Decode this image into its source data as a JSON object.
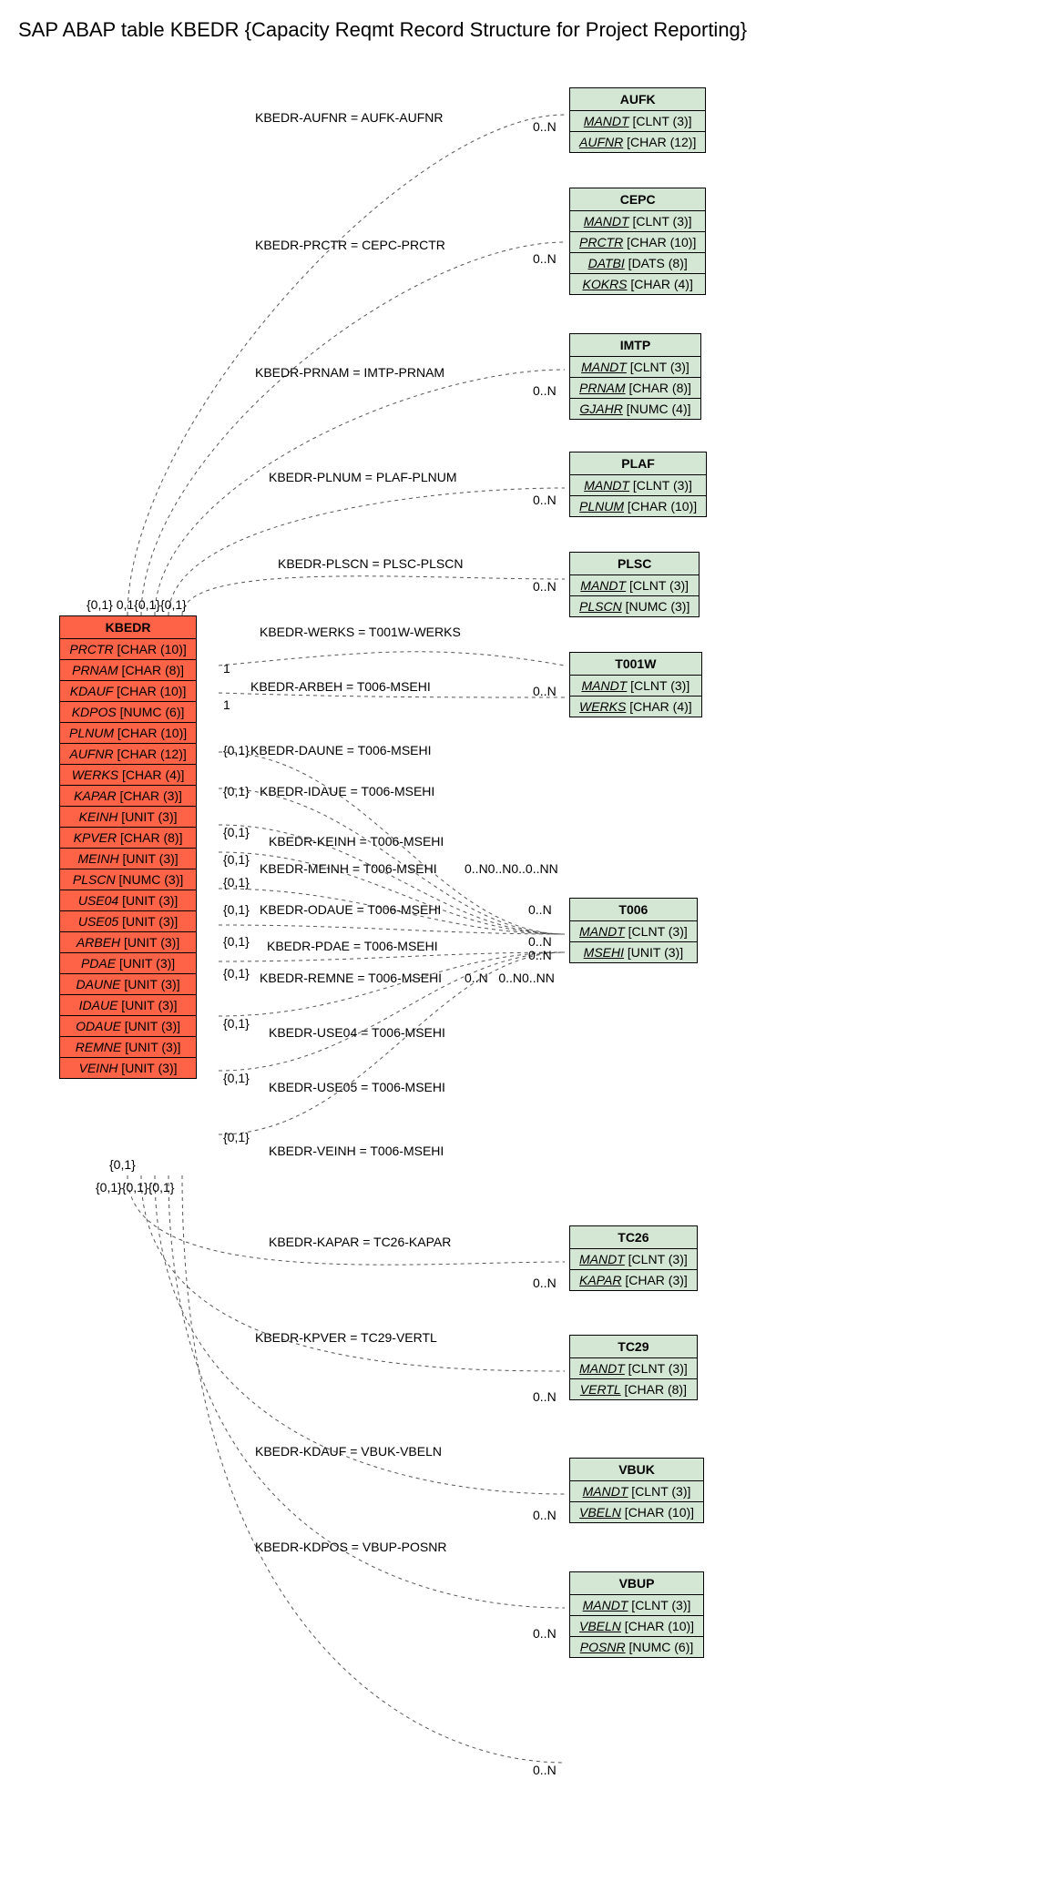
{
  "title": "SAP ABAP table KBEDR {Capacity Reqmt Record Structure for Project Reporting}",
  "main_entity": {
    "name": "KBEDR",
    "fields": [
      {
        "name": "PRCTR",
        "type": "[CHAR (10)]"
      },
      {
        "name": "PRNAM",
        "type": "[CHAR (8)]"
      },
      {
        "name": "KDAUF",
        "type": "[CHAR (10)]"
      },
      {
        "name": "KDPOS",
        "type": "[NUMC (6)]"
      },
      {
        "name": "PLNUM",
        "type": "[CHAR (10)]"
      },
      {
        "name": "AUFNR",
        "type": "[CHAR (12)]"
      },
      {
        "name": "WERKS",
        "type": "[CHAR (4)]"
      },
      {
        "name": "KAPAR",
        "type": "[CHAR (3)]"
      },
      {
        "name": "KEINH",
        "type": "[UNIT (3)]"
      },
      {
        "name": "KPVER",
        "type": "[CHAR (8)]"
      },
      {
        "name": "MEINH",
        "type": "[UNIT (3)]"
      },
      {
        "name": "PLSCN",
        "type": "[NUMC (3)]"
      },
      {
        "name": "USE04",
        "type": "[UNIT (3)]"
      },
      {
        "name": "USE05",
        "type": "[UNIT (3)]"
      },
      {
        "name": "ARBEH",
        "type": "[UNIT (3)]"
      },
      {
        "name": "PDAE",
        "type": "[UNIT (3)]"
      },
      {
        "name": "DAUNE",
        "type": "[UNIT (3)]"
      },
      {
        "name": "IDAUE",
        "type": "[UNIT (3)]"
      },
      {
        "name": "ODAUE",
        "type": "[UNIT (3)]"
      },
      {
        "name": "REMNE",
        "type": "[UNIT (3)]"
      },
      {
        "name": "VEINH",
        "type": "[UNIT (3)]"
      }
    ]
  },
  "related_entities": [
    {
      "name": "AUFK",
      "fields": [
        {
          "name": "MANDT",
          "type": "[CLNT (3)]",
          "u": true
        },
        {
          "name": "AUFNR",
          "type": "[CHAR (12)]",
          "u": true
        }
      ]
    },
    {
      "name": "CEPC",
      "fields": [
        {
          "name": "MANDT",
          "type": "[CLNT (3)]",
          "u": true
        },
        {
          "name": "PRCTR",
          "type": "[CHAR (10)]",
          "u": true
        },
        {
          "name": "DATBI",
          "type": "[DATS (8)]",
          "u": true
        },
        {
          "name": "KOKRS",
          "type": "[CHAR (4)]",
          "u": true
        }
      ]
    },
    {
      "name": "IMTP",
      "fields": [
        {
          "name": "MANDT",
          "type": "[CLNT (3)]",
          "u": true
        },
        {
          "name": "PRNAM",
          "type": "[CHAR (8)]",
          "u": true
        },
        {
          "name": "GJAHR",
          "type": "[NUMC (4)]",
          "u": true
        }
      ]
    },
    {
      "name": "PLAF",
      "fields": [
        {
          "name": "MANDT",
          "type": "[CLNT (3)]",
          "u": true
        },
        {
          "name": "PLNUM",
          "type": "[CHAR (10)]",
          "u": true
        }
      ]
    },
    {
      "name": "PLSC",
      "fields": [
        {
          "name": "MANDT",
          "type": "[CLNT (3)]",
          "u": true
        },
        {
          "name": "PLSCN",
          "type": "[NUMC (3)]",
          "u": true
        }
      ]
    },
    {
      "name": "T001W",
      "fields": [
        {
          "name": "MANDT",
          "type": "[CLNT (3)]",
          "u": true
        },
        {
          "name": "WERKS",
          "type": "[CHAR (4)]",
          "u": true
        }
      ]
    },
    {
      "name": "T006",
      "fields": [
        {
          "name": "MANDT",
          "type": "[CLNT (3)]",
          "u": true
        },
        {
          "name": "MSEHI",
          "type": "[UNIT (3)]",
          "u": true
        }
      ]
    },
    {
      "name": "TC26",
      "fields": [
        {
          "name": "MANDT",
          "type": "[CLNT (3)]",
          "u": true
        },
        {
          "name": "KAPAR",
          "type": "[CHAR (3)]",
          "u": true
        }
      ]
    },
    {
      "name": "TC29",
      "fields": [
        {
          "name": "MANDT",
          "type": "[CLNT (3)]",
          "u": true
        },
        {
          "name": "VERTL",
          "type": "[CHAR (8)]",
          "u": true
        }
      ]
    },
    {
      "name": "VBUK",
      "fields": [
        {
          "name": "MANDT",
          "type": "[CLNT (3)]",
          "u": true
        },
        {
          "name": "VBELN",
          "type": "[CHAR (10)]",
          "u": true
        }
      ]
    },
    {
      "name": "VBUP",
      "fields": [
        {
          "name": "MANDT",
          "type": "[CLNT (3)]",
          "u": true
        },
        {
          "name": "VBELN",
          "type": "[CHAR (10)]",
          "u": true
        },
        {
          "name": "POSNR",
          "type": "[NUMC (6)]",
          "u": true
        }
      ]
    }
  ],
  "relationships": [
    {
      "label": "KBEDR-AUFNR = AUFK-AUFNR",
      "src_card": "{0,1}",
      "dst_card": "0..N"
    },
    {
      "label": "KBEDR-PRCTR = CEPC-PRCTR",
      "src_card": "0,1",
      "dst_card": "0..N"
    },
    {
      "label": "KBEDR-PRNAM = IMTP-PRNAM",
      "src_card": "{0,1}",
      "dst_card": "0..N"
    },
    {
      "label": "KBEDR-PLNUM = PLAF-PLNUM",
      "src_card": "{0,1}",
      "dst_card": "0..N"
    },
    {
      "label": "KBEDR-PLSCN = PLSC-PLSCN",
      "src_card": "{0,1}",
      "dst_card": "0..N"
    },
    {
      "label": "KBEDR-WERKS = T001W-WERKS",
      "src_card": "1",
      "dst_card": "0..N"
    },
    {
      "label": "KBEDR-ARBEH = T006-MSEHI",
      "src_card": "1",
      "dst_card": "0..N"
    },
    {
      "label": "KBEDR-DAUNE = T006-MSEHI",
      "src_card": "{0,1}",
      "dst_card": "0..N"
    },
    {
      "label": "KBEDR-IDAUE = T006-MSEHI",
      "src_card": "{0,1}",
      "dst_card": "0..N"
    },
    {
      "label": "KBEDR-KEINH = T006-MSEHI",
      "src_card": "{0,1}",
      "dst_card": "0..N"
    },
    {
      "label": "KBEDR-MEINH = T006-MSEHI",
      "src_card": "{0,1}",
      "dst_card": "0..N"
    },
    {
      "label": "KBEDR-ODAUE = T006-MSEHI",
      "src_card": "{0,1}",
      "dst_card": "0..N"
    },
    {
      "label": "KBEDR-PDAE = T006-MSEHI",
      "src_card": "{0,1}",
      "dst_card": "0..N"
    },
    {
      "label": "KBEDR-REMNE = T006-MSEHI",
      "src_card": "{0,1}",
      "dst_card": "0..N"
    },
    {
      "label": "KBEDR-USE04 = T006-MSEHI",
      "src_card": "{0,1}",
      "dst_card": "0..N"
    },
    {
      "label": "KBEDR-USE05 = T006-MSEHI",
      "src_card": "{0,1}",
      "dst_card": "0..N"
    },
    {
      "label": "KBEDR-VEINH = T006-MSEHI",
      "src_card": "{0,1}",
      "dst_card": "0..N"
    },
    {
      "label": "KBEDR-KAPAR = TC26-KAPAR",
      "src_card": "{0,1}",
      "dst_card": "0..N"
    },
    {
      "label": "KBEDR-KPVER = TC29-VERTL",
      "src_card": "{0,1}",
      "dst_card": "0..N"
    },
    {
      "label": "KBEDR-KDAUF = VBUK-VBELN",
      "src_card": "{0,1}",
      "dst_card": "0..N"
    },
    {
      "label": "KBEDR-KDPOS = VBUP-POSNR",
      "src_card": "{0,1}",
      "dst_card": "0..N"
    }
  ],
  "src_card_cluster_top": "{0,1} 0,1{0,1}{0,1}",
  "src_card_cluster_bottom": "{0,1}{0,1}{0,1}"
}
